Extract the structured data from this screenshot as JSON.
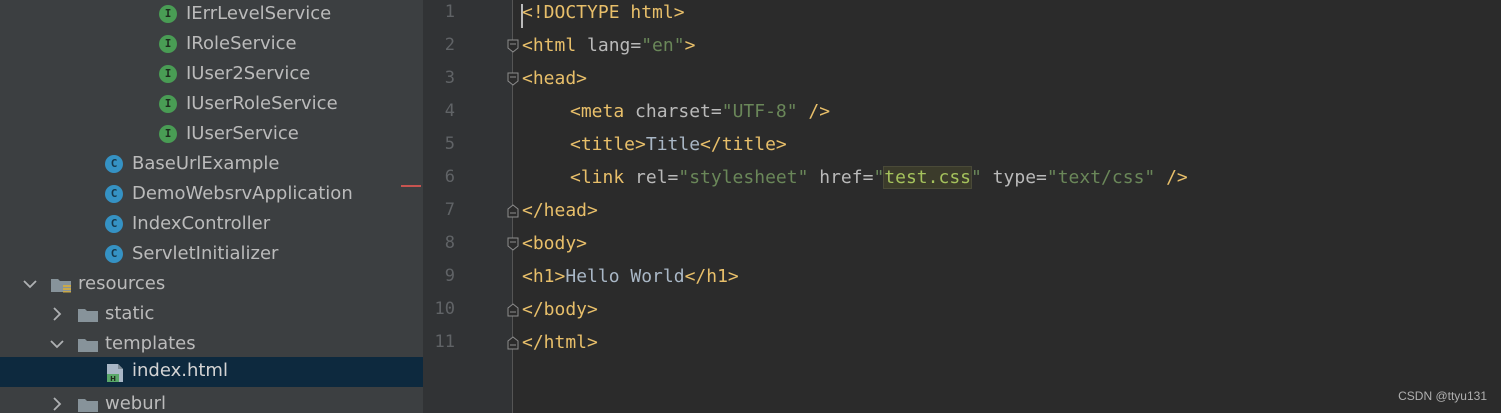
{
  "tree": {
    "interfaces": [
      "IErrLevelService",
      "IRoleService",
      "IUser2Service",
      "IUserRoleService",
      "IUserService"
    ],
    "classes": [
      "BaseUrlExample",
      "DemoWebsrvApplication",
      "IndexController",
      "ServletInitializer"
    ],
    "interface_badge": "I",
    "class_badge": "C",
    "resources": "resources",
    "static": "static",
    "templates": "templates",
    "index_file": "index.html",
    "weburl": "weburl"
  },
  "editor": {
    "line_numbers": [
      "1",
      "2",
      "3",
      "4",
      "5",
      "6",
      "7",
      "8",
      "9",
      "10",
      "11"
    ],
    "l1": "<!DOCTYPE html>",
    "l2_open": "<html",
    "l2_attr": " lang=",
    "l2_val": "\"en\"",
    "l2_close": ">",
    "l3": "<head>",
    "l4_open": "<meta",
    "l4_attr": " charset=",
    "l4_val": "\"UTF-8\"",
    "l4_close": " />",
    "l5_open": "<title>",
    "l5_text": "Title",
    "l5_close": "</title>",
    "l6_open": "<link",
    "l6_attr1": " rel=",
    "l6_val1": "\"stylesheet\"",
    "l6_attr2": " href=",
    "l6_q1": "\"",
    "l6_href": "test.css",
    "l6_q2": "\"",
    "l6_attr3": " type=",
    "l6_val3": "\"text/css\"",
    "l6_close": " />",
    "l7": "</head>",
    "l8": "<body>",
    "l9_open": "<h1>",
    "l9_text": "Hello World",
    "l9_close": "</h1>",
    "l10": "</body>",
    "l11": "</html>"
  },
  "watermark": "CSDN @ttyu131",
  "colors": {
    "tree_bg": "#3c3f41",
    "editor_bg": "#2b2b2b",
    "tag": "#e8bf6a",
    "string": "#6a8759",
    "selection": "#0d293e"
  }
}
